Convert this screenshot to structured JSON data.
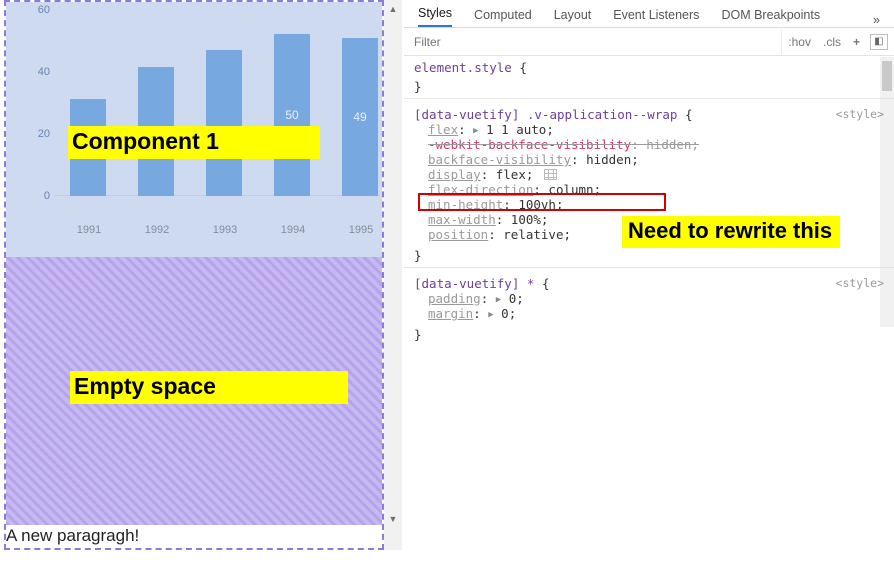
{
  "chart_data": {
    "type": "bar",
    "categories": [
      "1991",
      "1992",
      "1993",
      "1994",
      "1995"
    ],
    "values": [
      30,
      40,
      45,
      50,
      49
    ],
    "shown_labels": [
      null,
      null,
      null,
      "50",
      "49"
    ],
    "y_ticks": [
      0,
      20,
      40,
      60
    ],
    "ylim": [
      0,
      60
    ],
    "title": "",
    "xlabel": "",
    "ylabel": ""
  },
  "annotations": {
    "component1": "Component 1",
    "empty_space": "Empty space",
    "rewrite_note": "Need to rewrite this"
  },
  "paragraph": "A new paragragh!",
  "devtools": {
    "tabs": [
      "Styles",
      "Computed",
      "Layout",
      "Event Listeners",
      "DOM Breakpoints"
    ],
    "active_tab": 0,
    "more_glyph": "»",
    "filter_placeholder": "Filter",
    "toolbar": {
      "hov": ":hov",
      "cls": ".cls",
      "plus": "+",
      "toggle": "◧"
    },
    "style_origin": "<style>",
    "rule1": {
      "selector": "element.style",
      "open": "{",
      "close": "}"
    },
    "rule2": {
      "selector": "[data-vuetify] .v-application--wrap",
      "open": "{",
      "close": "}",
      "decls": [
        {
          "prop": "flex",
          "val": "1 1 auto",
          "has_tri": true
        },
        {
          "prop": "-webkit-backface-visibility",
          "val": "hidden",
          "struck": true
        },
        {
          "prop": "backface-visibility",
          "val": "hidden"
        },
        {
          "prop": "display",
          "val": "flex",
          "has_icon": true
        },
        {
          "prop": "flex-direction",
          "val": "column"
        },
        {
          "prop": "min-height",
          "val": "100vh",
          "boxed": true
        },
        {
          "prop": "max-width",
          "val": "100%"
        },
        {
          "prop": "position",
          "val": "relative"
        }
      ]
    },
    "rule3": {
      "selector": "[data-vuetify] *",
      "open": "{",
      "close": "}",
      "decls": [
        {
          "prop": "padding",
          "val": "0",
          "has_tri": true
        },
        {
          "prop": "margin",
          "val": "0",
          "has_tri": true
        }
      ]
    }
  }
}
